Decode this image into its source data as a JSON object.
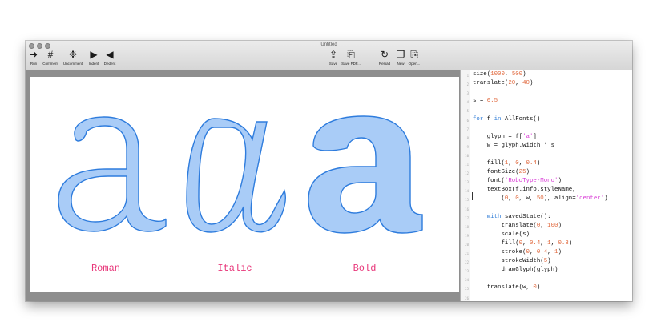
{
  "window": {
    "title": "Untitled"
  },
  "toolbar": {
    "left": [
      {
        "label": "Run",
        "icon": "➜",
        "name": "run"
      },
      {
        "label": "Comment",
        "icon": "#",
        "name": "comment"
      },
      {
        "label": "Uncomment",
        "icon": "❉",
        "name": "uncomment"
      },
      {
        "label": "Indent",
        "icon": "▶",
        "name": "indent"
      },
      {
        "label": "Dedent",
        "icon": "◀",
        "name": "dedent"
      }
    ],
    "center": [
      {
        "label": "Save",
        "icon": "⇪",
        "name": "save"
      },
      {
        "label": "Save PDF...",
        "icon": "⎗",
        "name": "save-pdf"
      }
    ],
    "right": [
      {
        "label": "Reload",
        "icon": "↻",
        "name": "reload"
      },
      {
        "label": "New",
        "icon": "❐",
        "name": "new"
      },
      {
        "label": "Open...",
        "icon": "⎘",
        "name": "open"
      }
    ]
  },
  "canvas": {
    "glyph_labels": [
      "Roman",
      "Italic",
      "Bold"
    ],
    "colors": {
      "fill": "#a9ccf7",
      "stroke": "#2e7cdd",
      "label": "#e8377a"
    }
  },
  "editor": {
    "line_numbers": [
      "1",
      "2",
      "3",
      "4",
      "5",
      "6",
      "7",
      "8",
      "9",
      "10",
      "11",
      "12",
      "13",
      "14",
      "15",
      "16",
      "17",
      "18",
      "19",
      "20",
      "21",
      "22",
      "23",
      "24",
      "25",
      "26"
    ],
    "lines": [
      "size(1000, 500)",
      "translate(20, 40)",
      "",
      "s = 0.5",
      "",
      "for f in AllFonts():",
      "",
      "    glyph = f['a']",
      "    w = glyph.width * s",
      "",
      "    fill(1, 0, 0.4)",
      "    fontSize(25)",
      "    font('RoboType-Mono')",
      "    textBox(f.info.styleName,",
      "        (0, 0, w, 50), align='center')",
      "",
      "    with savedState():",
      "        translate(0, 100)",
      "        scale(s)",
      "        fill(0, 0.4, 1, 0.3)",
      "        stroke(0, 0.4, 1)",
      "        strokeWidth(5)",
      "        drawGlyph(glyph)",
      "",
      "    translate(w, 0)",
      ""
    ]
  }
}
